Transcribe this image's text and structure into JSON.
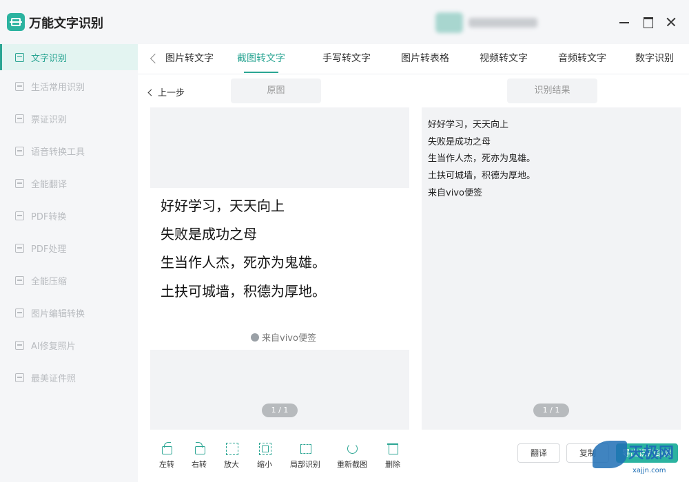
{
  "app": {
    "title": "万能文字识别"
  },
  "sidebar": {
    "items": [
      {
        "label": "文字识别",
        "icon": "text-scan-icon",
        "active": true
      },
      {
        "label": "生活常用识别",
        "icon": "scan-icon"
      },
      {
        "label": "票证识别",
        "icon": "ticket-scan-icon"
      },
      {
        "label": "语音转换工具",
        "icon": "voice-convert-icon"
      },
      {
        "label": "全能翻译",
        "icon": "translate-icon"
      },
      {
        "label": "PDF转换",
        "icon": "pdf-convert-icon"
      },
      {
        "label": "PDF处理",
        "icon": "pdf-process-icon"
      },
      {
        "label": "全能压缩",
        "icon": "compress-icon"
      },
      {
        "label": "图片编辑转换",
        "icon": "image-edit-icon"
      },
      {
        "label": "AI修复照片",
        "icon": "photo-repair-icon"
      },
      {
        "label": "最美证件照",
        "icon": "id-photo-icon"
      }
    ]
  },
  "tabs": [
    {
      "label": "图片转文字"
    },
    {
      "label": "截图转文字",
      "active": true
    },
    {
      "label": "手写转文字"
    },
    {
      "label": "图片转表格"
    },
    {
      "label": "视频转文字"
    },
    {
      "label": "音频转文字"
    },
    {
      "label": "数字识别"
    }
  ],
  "content": {
    "back_label": "上一步",
    "source_tag": "原图",
    "result_tag": "识别结果",
    "source_lines": [
      "好好学习，天天向上",
      "失败是成功之母",
      "生当作人杰，死亦为鬼雄。",
      "土扶可城墙，积德为厚地。"
    ],
    "source_footer": "来自vivo便签",
    "source_page": "1 / 1",
    "result_lines": [
      "好好学习，天天向上",
      "失败是成功之母",
      "生当作人杰，死亦为鬼雄。",
      "土扶可城墙，积德为厚地。",
      "来自vivo便签"
    ],
    "result_page": "1 / 1"
  },
  "toolbar": {
    "rotate_left": "左转",
    "rotate_right": "右转",
    "zoom_in": "放大",
    "zoom_out": "缩小",
    "partial": "局部识别",
    "reshot": "重新截图",
    "delete": "删除"
  },
  "actions": {
    "translate": "翻译",
    "copy": "复制",
    "export": "导出识别结果"
  },
  "watermark": {
    "text": "天极网",
    "sub": "xajjn.com"
  },
  "colors": {
    "accent": "#2aa593",
    "panel": "#f2f3f5"
  }
}
